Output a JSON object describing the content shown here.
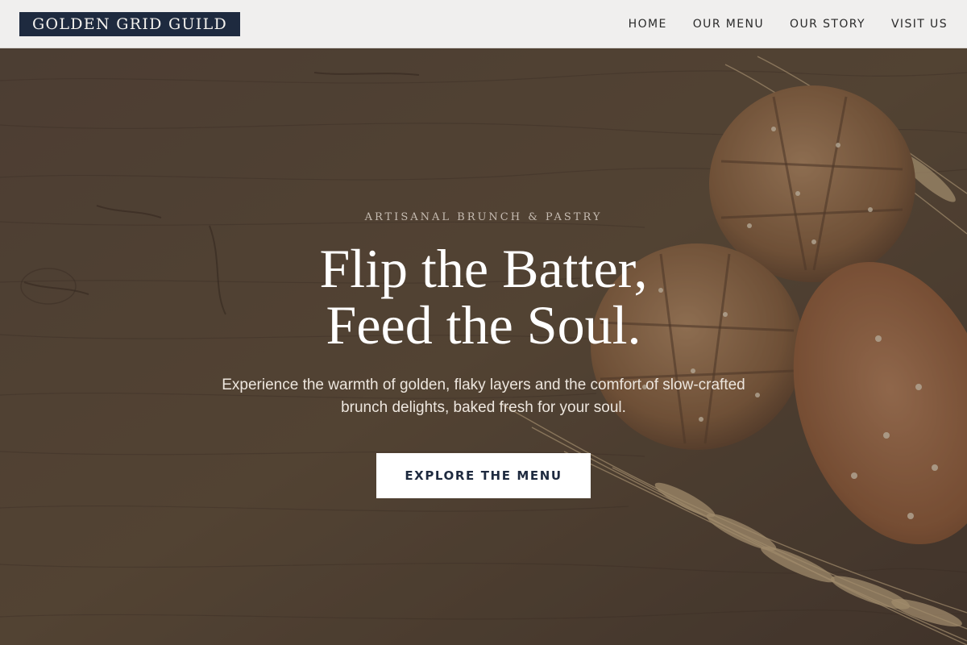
{
  "navbar": {
    "brand": "GOLDEN GRID GUILD",
    "links": [
      "HOME",
      "OUR MENU",
      "OUR STORY",
      "VISIT US"
    ]
  },
  "hero": {
    "eyebrow": "ARTISANAL BRUNCH & PASTRY",
    "headline_line1": "Flip the Batter,",
    "headline_line2": "Feed the Soul.",
    "subtext": "Experience the warmth of golden, flaky layers and the comfort of slow-crafted brunch delights, baked fresh for your soul.",
    "cta_label": "EXPLORE THE MENU"
  },
  "colors": {
    "brand_bg": "#1e2a3f",
    "nav_bg": "#f0efee",
    "hero_wood": "#5a4a3e",
    "cta_bg": "#ffffff",
    "cta_text": "#1e2a3f"
  },
  "icons": [
    "bread-loaf-image",
    "wheat-stalk-image"
  ]
}
